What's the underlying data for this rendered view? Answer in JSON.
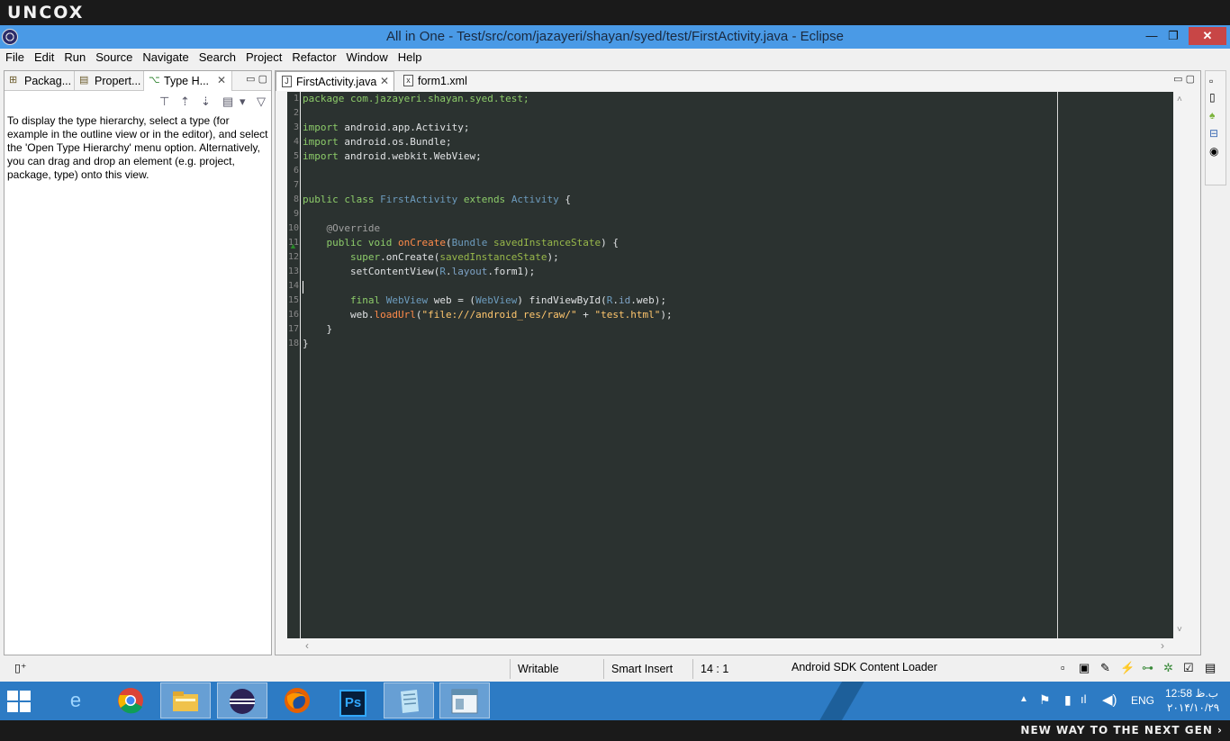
{
  "brand": {
    "logo": "uncox",
    "slogan": "new way to the next gen ›"
  },
  "window": {
    "title": "All in One - Test/src/com/jazayeri/shayan/syed/test/FirstActivity.java - Eclipse",
    "minimize": "—",
    "maximize": "❐",
    "close": "✕"
  },
  "menu": [
    "File",
    "Edit",
    "Run",
    "Source",
    "Navigate",
    "Search",
    "Project",
    "Refactor",
    "Window",
    "Help"
  ],
  "left_panel": {
    "tabs": [
      {
        "label": "Packag...",
        "icon": "package-explorer-icon"
      },
      {
        "label": "Propert...",
        "icon": "properties-icon"
      },
      {
        "label": "Type H...",
        "icon": "type-hierarchy-icon"
      }
    ],
    "close": "✕",
    "message": "To display the type hierarchy, select a type (for example in the outline view or in the editor), and select the 'Open Type Hierarchy' menu option. Alternatively, you can drag and drop an element (e.g. project, package, type) onto this view."
  },
  "editor": {
    "tabs": [
      {
        "label": "FirstActivity.java",
        "icon": "java-file-icon",
        "glyph": "J"
      },
      {
        "label": "form1.xml",
        "icon": "xml-file-icon",
        "glyph": "x"
      }
    ],
    "close": "✕",
    "line_numbers": [
      "1",
      "2",
      "3",
      "4",
      "5",
      "6",
      "7",
      "8",
      "9",
      "10",
      "11",
      "12",
      "13",
      "14",
      "15",
      "16",
      "17",
      "18"
    ],
    "lines": [
      [
        {
          "t": "package com.jazayeri.shayan.syed.test;",
          "c": "kw"
        }
      ],
      [],
      [
        {
          "t": "import",
          "c": "kw"
        },
        {
          "t": " android.app.Activity;",
          "c": ""
        }
      ],
      [
        {
          "t": "import",
          "c": "kw"
        },
        {
          "t": " android.os.Bundle;",
          "c": ""
        }
      ],
      [
        {
          "t": "import",
          "c": "kw"
        },
        {
          "t": " android.webkit.WebView;",
          "c": ""
        }
      ],
      [],
      [],
      [
        {
          "t": "public class",
          "c": "kw"
        },
        {
          "t": " ",
          "c": ""
        },
        {
          "t": "FirstActivity",
          "c": "typ"
        },
        {
          "t": " extends ",
          "c": "kw"
        },
        {
          "t": "Activity",
          "c": "typ"
        },
        {
          "t": " {",
          "c": ""
        }
      ],
      [],
      [
        {
          "t": "    @Override",
          "c": "ann"
        }
      ],
      [
        {
          "t": "    public void ",
          "c": "kw"
        },
        {
          "t": "onCreate",
          "c": "mth"
        },
        {
          "t": "(",
          "c": ""
        },
        {
          "t": "Bundle",
          "c": "typ"
        },
        {
          "t": " ",
          "c": ""
        },
        {
          "t": "savedInstanceState",
          "c": "par"
        },
        {
          "t": ") {",
          "c": ""
        }
      ],
      [
        {
          "t": "        super",
          "c": "kw"
        },
        {
          "t": ".onCreate(",
          "c": ""
        },
        {
          "t": "savedInstanceState",
          "c": "par"
        },
        {
          "t": ");",
          "c": ""
        }
      ],
      [
        {
          "t": "        setContentView(",
          "c": ""
        },
        {
          "t": "R",
          "c": "typ"
        },
        {
          "t": ".",
          "c": ""
        },
        {
          "t": "layout",
          "c": "fld"
        },
        {
          "t": ".form1);",
          "c": ""
        }
      ],
      [],
      [
        {
          "t": "        final ",
          "c": "kw"
        },
        {
          "t": "WebView",
          "c": "typ"
        },
        {
          "t": " web = (",
          "c": ""
        },
        {
          "t": "WebView",
          "c": "typ"
        },
        {
          "t": ") findViewById(",
          "c": ""
        },
        {
          "t": "R",
          "c": "typ"
        },
        {
          "t": ".",
          "c": ""
        },
        {
          "t": "id",
          "c": "fld"
        },
        {
          "t": ".web);",
          "c": ""
        }
      ],
      [
        {
          "t": "        web.",
          "c": ""
        },
        {
          "t": "loadUrl",
          "c": "mth"
        },
        {
          "t": "(",
          "c": ""
        },
        {
          "t": "\"file:///android_res/raw/\"",
          "c": "str"
        },
        {
          "t": " + ",
          "c": ""
        },
        {
          "t": "\"test.html\"",
          "c": "str"
        },
        {
          "t": ");",
          "c": ""
        }
      ],
      [
        {
          "t": "    }",
          "c": ""
        }
      ],
      [
        {
          "t": "}",
          "c": ""
        }
      ]
    ]
  },
  "status": {
    "writable": "Writable",
    "insert_mode": "Smart Insert",
    "position": "14 : 1",
    "task": "Android SDK Content Loader"
  },
  "taskbar": {
    "clock_time": "12:58 ب.ظ",
    "clock_date": "۲۰۱۴/۱۰/۲۹",
    "language": "ENG",
    "apps": [
      "internet-explorer-icon",
      "chrome-icon",
      "file-explorer-icon",
      "eclipse-icon",
      "firefox-icon",
      "photoshop-icon",
      "notepad-icon",
      "window-app-icon"
    ],
    "photoshop_label": "Ps"
  }
}
